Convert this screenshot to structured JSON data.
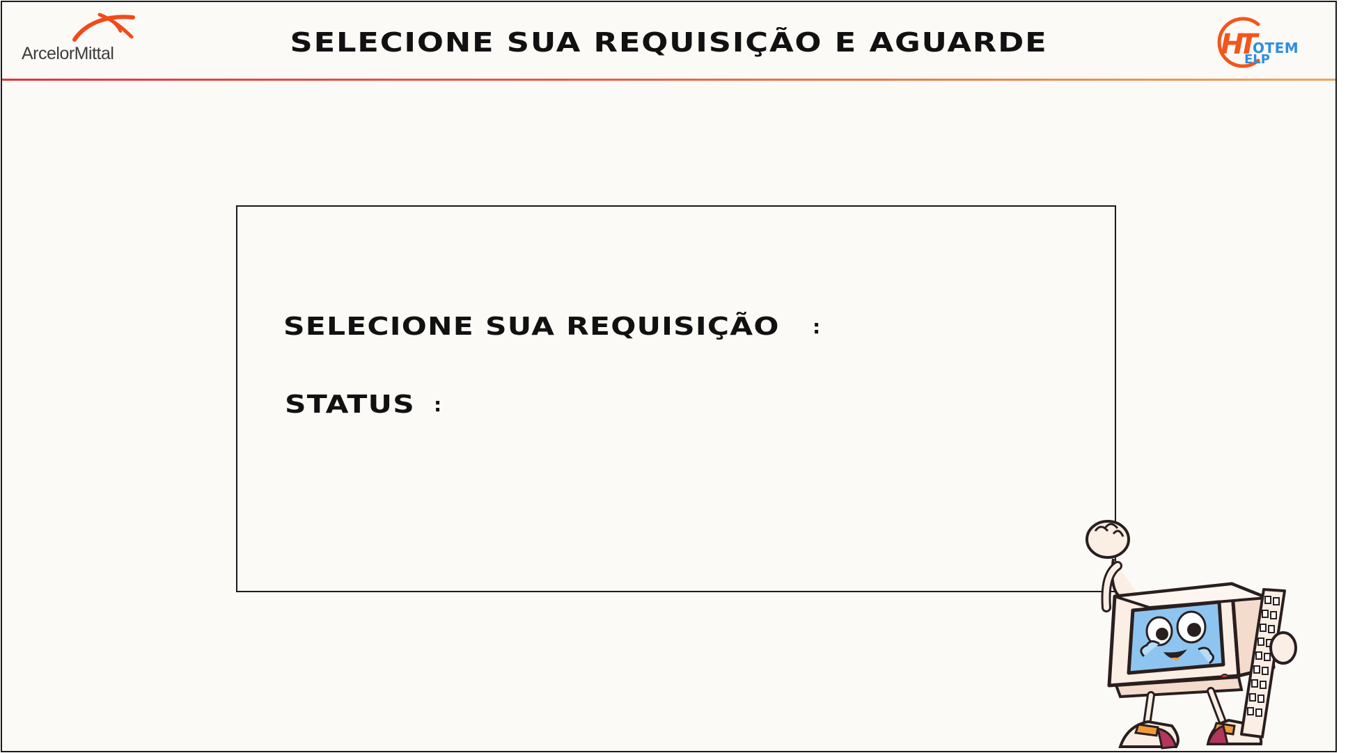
{
  "header": {
    "title": "SELECIONE SUA REQUISIÇÃO E AGUARDE",
    "left_logo": {
      "text": "ArcelorMittal",
      "accent": "#f24a1a"
    },
    "right_logo": {
      "line1": "OTEM",
      "line2": "ELP",
      "accent": "#f2561d",
      "text_color": "#2d8ee0"
    },
    "divider_colors": [
      "#e2343c",
      "#f4a15e"
    ]
  },
  "panel": {
    "request_label": "SELECIONE SUA REQUISIÇÃO",
    "request_colon": ":",
    "status_label": "STATUS",
    "status_colon": ":"
  },
  "mascot": {
    "icon": "retro-computer-mascot-icon"
  }
}
